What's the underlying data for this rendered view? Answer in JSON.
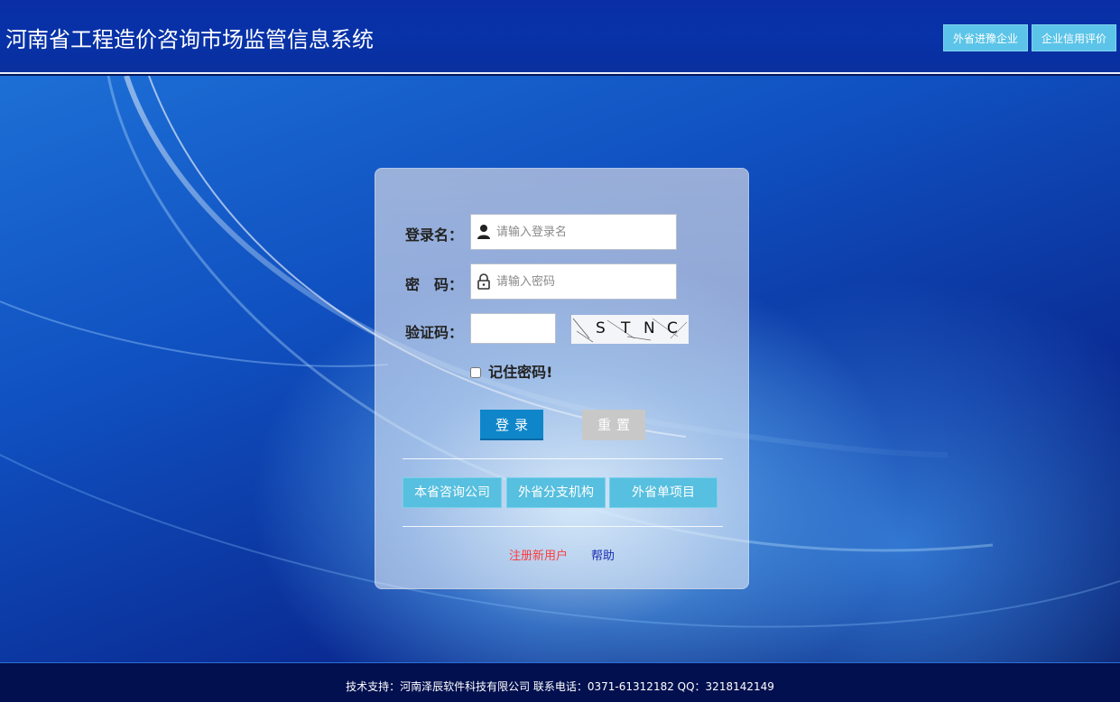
{
  "header": {
    "title": "河南省工程造价咨询市场监管信息系统",
    "buttons": [
      "外省进豫企业",
      "企业信用评价"
    ]
  },
  "login": {
    "username_label": "登录名：",
    "username_placeholder": "请输入登录名",
    "password_label": "密　码：",
    "password_placeholder": "请输入密码",
    "captcha_label": "验证码：",
    "captcha_chars": [
      "S",
      "T",
      "N",
      "C"
    ],
    "remember_label": "记住密码!",
    "login_button": "登录",
    "reset_button": "重置"
  },
  "nav_buttons": [
    "本省咨询公司",
    "外省分支机构",
    "外省单项目"
  ],
  "links": {
    "register": "注册新用户",
    "help": "帮助"
  },
  "footer": {
    "text": "技术支持：河南泽辰软件科技有限公司  联系电话：0371-61312182  QQ：3218142149"
  },
  "colors": {
    "header_bg": "#0a2ea6",
    "accent_button": "#5cc4e8",
    "login_button": "#0f86c9",
    "register_link": "#ff3b3b",
    "help_link": "#1a2fb0",
    "footer_bg": "#03104f"
  },
  "icons": {
    "username": "user-icon",
    "password": "lock-icon"
  }
}
